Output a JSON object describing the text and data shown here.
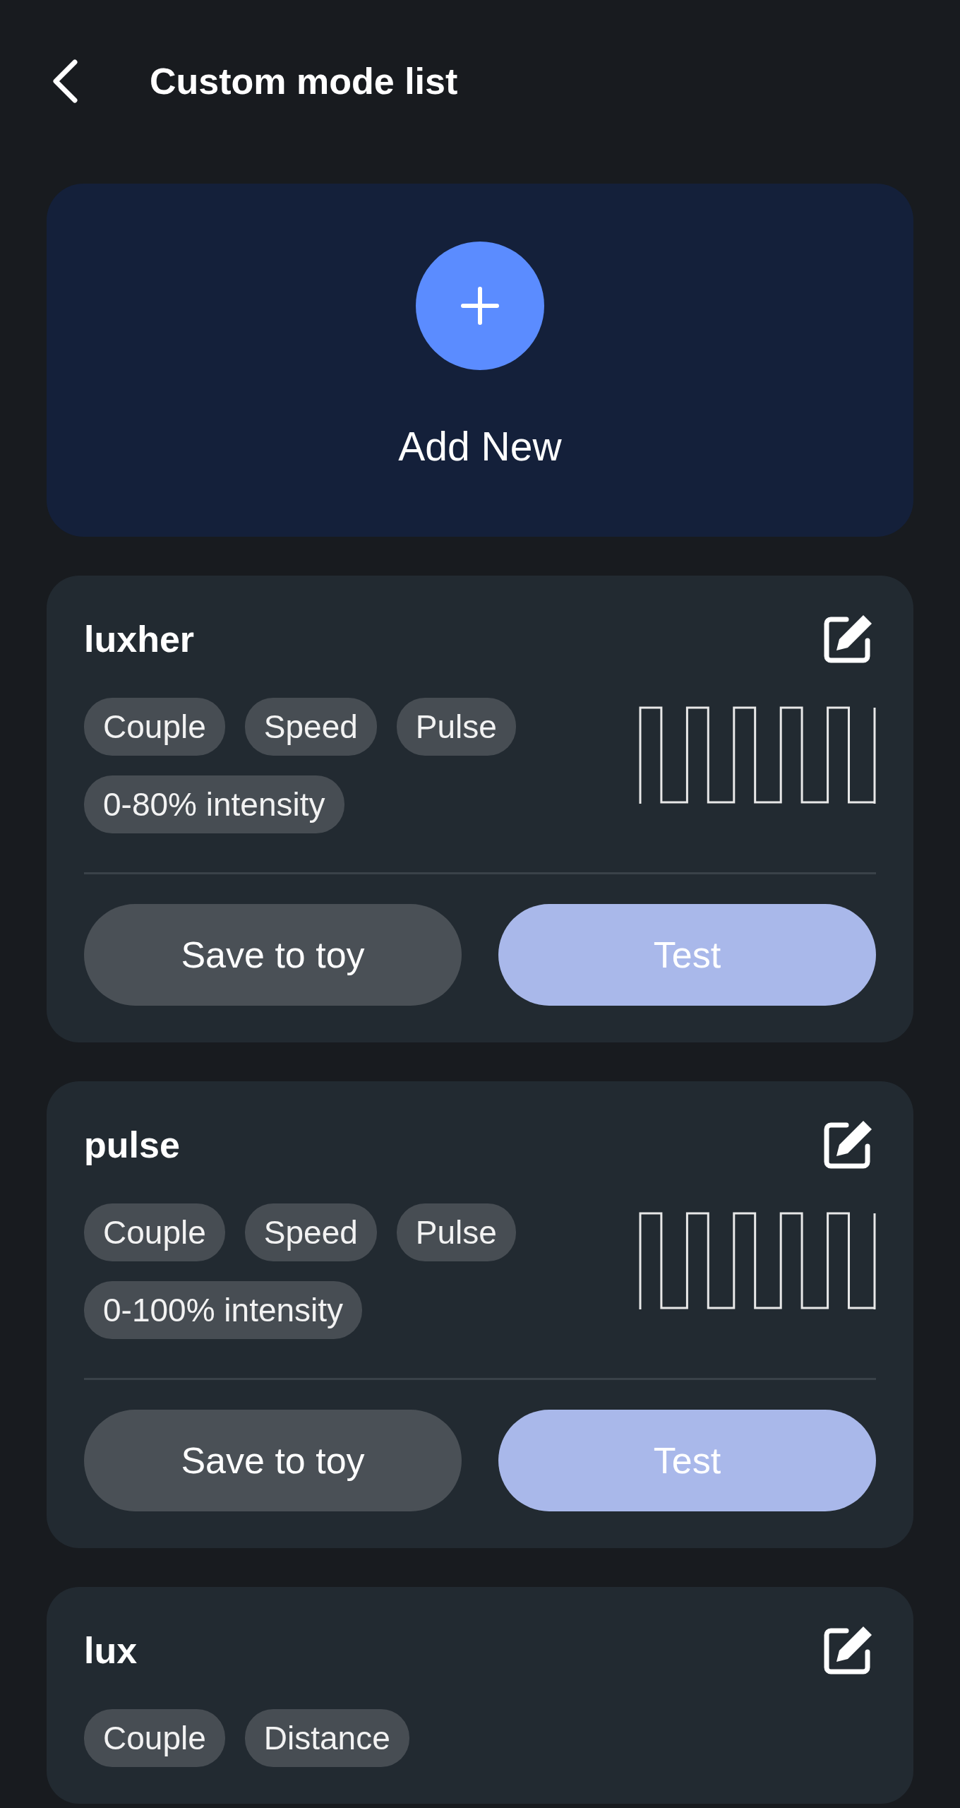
{
  "header": {
    "title": "Custom mode list"
  },
  "add_card": {
    "label": "Add New"
  },
  "modes": [
    {
      "name": "luxher",
      "tags": [
        "Couple",
        "Speed",
        "Pulse",
        "0-80% intensity"
      ],
      "buttons": [
        "Save to toy",
        "Test"
      ]
    },
    {
      "name": "pulse",
      "tags": [
        "Couple",
        "Speed",
        "Pulse",
        "0-100% intensity"
      ],
      "buttons": [
        "Save to toy",
        "Test"
      ]
    },
    {
      "name": "lux",
      "tags": [
        "Couple",
        "Distance"
      ]
    }
  ]
}
